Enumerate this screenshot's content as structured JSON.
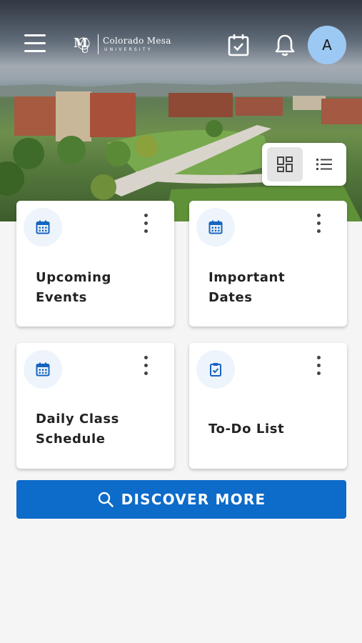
{
  "brand": {
    "name": "Colorado Mesa",
    "sub": "UNIVERSITY",
    "monogram": "MU"
  },
  "header": {
    "avatar_initial": "A"
  },
  "view_toggle": {
    "selected": "grid"
  },
  "cards": [
    {
      "title_line1": "Upcoming",
      "title_line2": "Events",
      "icon": "calendar-icon"
    },
    {
      "title_line1": "Important",
      "title_line2": "Dates",
      "icon": "calendar-icon"
    },
    {
      "title_line1": "Daily Class",
      "title_line2": "Schedule",
      "icon": "calendar-icon"
    },
    {
      "title_line1": "To-Do List",
      "title_line2": "",
      "icon": "clipboard-check-icon"
    }
  ],
  "discover": {
    "label": "DISCOVER MORE"
  },
  "colors": {
    "primary": "#0d6bc9",
    "avatar_bg": "#9cc9f3",
    "card_icon_bg": "#eef4fb",
    "page_bg": "#f5f5f5"
  }
}
